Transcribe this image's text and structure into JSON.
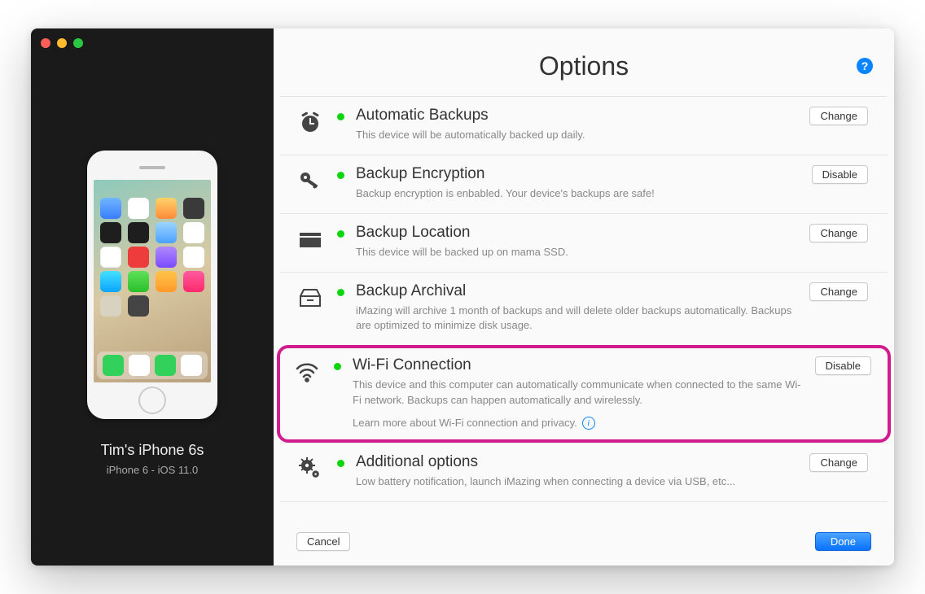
{
  "sidebar": {
    "device_name": "Tim's iPhone 6s",
    "device_meta": "iPhone 6 - iOS 11.0"
  },
  "header": {
    "title": "Options"
  },
  "options": {
    "automatic_backups": {
      "title": "Automatic Backups",
      "desc": "This device will be automatically backed up daily.",
      "action": "Change"
    },
    "backup_encryption": {
      "title": "Backup Encryption",
      "desc": "Backup encryption is enbabled. Your device's backups are safe!",
      "action": "Disable"
    },
    "backup_location": {
      "title": "Backup Location",
      "desc": "This device will be backed up on mama SSD.",
      "action": "Change"
    },
    "backup_archival": {
      "title": "Backup Archival",
      "desc": "iMazing will archive 1 month of backups and will delete older backups automatically. Backups are optimized to minimize disk usage.",
      "action": "Change"
    },
    "wifi": {
      "title": "Wi-Fi Connection",
      "desc": "This device and this computer can automatically communicate when connected to the same Wi-Fi network. Backups can happen automatically and wirelessly.",
      "link": "Learn more about Wi-Fi connection and privacy.",
      "action": "Disable"
    },
    "additional": {
      "title": "Additional options",
      "desc": "Low battery notification, launch iMazing when connecting a device via USB, etc...",
      "action": "Change"
    }
  },
  "footer": {
    "cancel": "Cancel",
    "done": "Done"
  },
  "colors": {
    "highlight": "#d21b8f",
    "primary": "#0a84ff",
    "status_ok": "#0cd50c"
  }
}
